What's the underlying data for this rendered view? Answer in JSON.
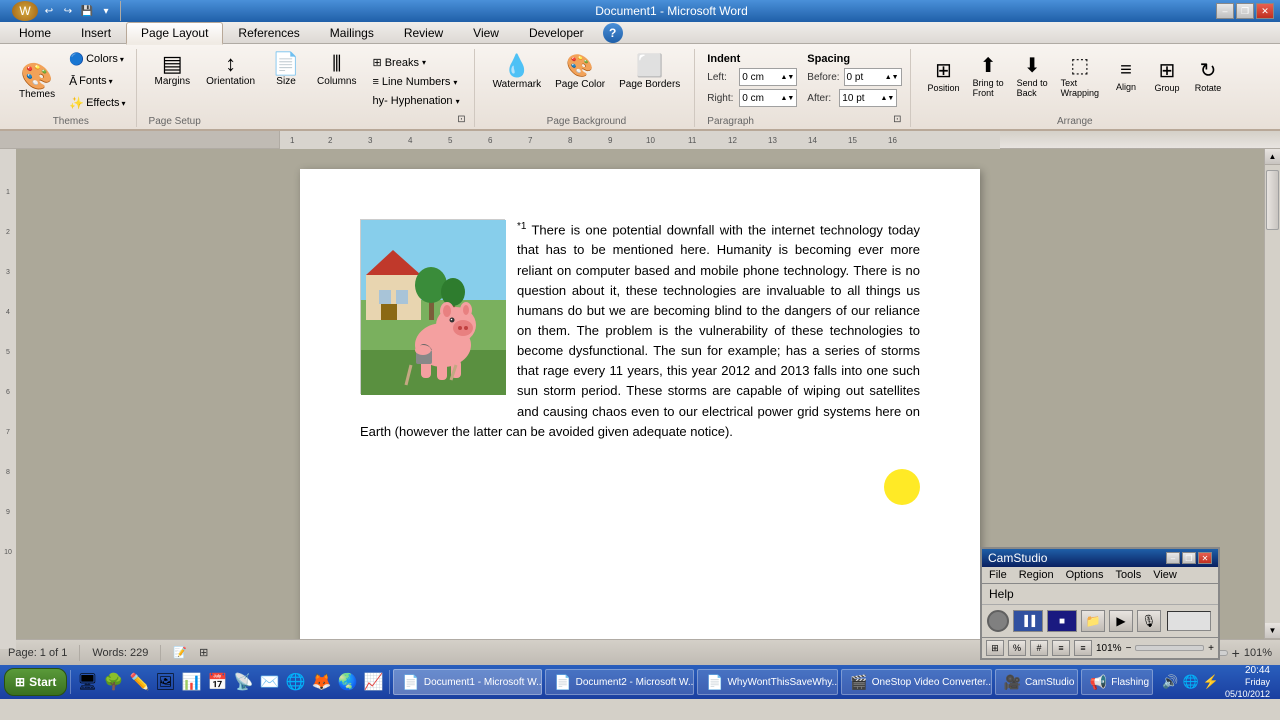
{
  "window": {
    "title": "Document1 - Microsoft Word"
  },
  "titlebar": {
    "title": "Document1 - Microsoft Word",
    "minimize": "–",
    "restore": "❐",
    "close": "✕",
    "quick_access": [
      "↩",
      "↪",
      "⟳",
      "💾"
    ]
  },
  "ribbon": {
    "tabs": [
      {
        "id": "home",
        "label": "Home"
      },
      {
        "id": "insert",
        "label": "Insert"
      },
      {
        "id": "page_layout",
        "label": "Page Layout",
        "active": true
      },
      {
        "id": "references",
        "label": "References"
      },
      {
        "id": "mailings",
        "label": "Mailings"
      },
      {
        "id": "review",
        "label": "Review"
      },
      {
        "id": "view",
        "label": "View"
      },
      {
        "id": "developer",
        "label": "Developer"
      }
    ],
    "groups": {
      "themes": {
        "label": "Themes",
        "themes_btn": "Themes",
        "colors_btn": "Colors",
        "fonts_btn": "Fonts",
        "effects_btn": "Effects"
      },
      "page_setup": {
        "label": "Page Setup",
        "margins": "Margins",
        "orientation": "Orientation",
        "size": "Size",
        "columns": "Columns",
        "breaks": "Breaks",
        "line_numbers": "Line Numbers",
        "hyphenation": "Hyphenation",
        "expand_icon": "⬛"
      },
      "page_background": {
        "label": "Page Background",
        "watermark": "Watermark",
        "page_color": "Page Color",
        "page_borders": "Page Borders"
      },
      "paragraph": {
        "label": "Paragraph",
        "indent_label": "Indent",
        "left_label": "Left:",
        "left_value": "0 cm",
        "right_label": "Right:",
        "right_value": "0 cm",
        "spacing_label": "Spacing",
        "before_label": "Before:",
        "before_value": "0 pt",
        "after_label": "After:",
        "after_value": "10 pt"
      },
      "arrange": {
        "label": "Arrange",
        "position": "Position",
        "bring_to_front": "Bring to Front",
        "send_to_back": "Send to Back",
        "text_wrapping": "Text Wrapping",
        "align": "Align",
        "group": "Group",
        "rotate": "Rotate"
      }
    }
  },
  "document": {
    "footnote_marker": "*1",
    "text": "There is one potential downfall with the internet technology today that has to be mentioned here. Humanity is becoming ever more reliant on computer based and mobile phone technology. There is no question about it, these technologies are invaluable to all things us humans do but we are becoming blind to the dangers of our reliance on them. The problem is the vulnerability of these technologies to become dysfunctional. The sun for example; has a series of storms that rage every 11 years, this year 2012 and 2013 falls into one such sun storm period. These storms are capable of wiping out satellites and causing chaos even to our electrical power grid systems here on Earth (however the latter can be avoided given adequate notice)."
  },
  "statusbar": {
    "page_info": "Page: 1 of 1",
    "words": "Words: 229"
  },
  "camstudio": {
    "title": "CamStudio",
    "menu": [
      "File",
      "Region",
      "Options",
      "Tools",
      "View"
    ],
    "help": "Help",
    "zoom": "101%"
  },
  "taskbar": {
    "start_label": "Start",
    "buttons": [
      {
        "id": "doc1",
        "label": "Document1 - Microsoft W...",
        "icon": "📄"
      },
      {
        "id": "doc2",
        "label": "Document2 - Microsoft W...",
        "icon": "📄"
      },
      {
        "id": "why",
        "label": "WhyWontThisSaveWhy...",
        "icon": "📄"
      },
      {
        "id": "onestop",
        "label": "OneStop Video Converter...",
        "icon": "🎬"
      },
      {
        "id": "camstudio_task",
        "label": "CamStudio",
        "icon": "🎥"
      },
      {
        "id": "flashing",
        "label": "Flashing",
        "icon": "📢"
      }
    ],
    "tray": {
      "time": "20:44",
      "date": "Friday\n05/10/2012"
    }
  }
}
